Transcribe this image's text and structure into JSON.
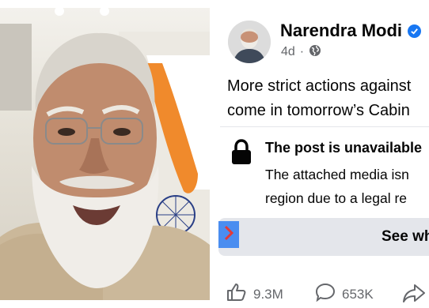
{
  "post": {
    "author": "Narendra Modi",
    "time": "4d",
    "text_line1": "More strict actions against",
    "text_line2": "come in tomorrow’s Cabin",
    "unavailable_title": "The post is unavailable",
    "unavailable_line1": "The attached media isn",
    "unavailable_line2": "region due to a legal re",
    "see_why_label": "See wh",
    "likes": "9.3M",
    "comments": "653K"
  },
  "icons": {
    "verified": "verified-badge-icon",
    "audience": "globe-icon",
    "lock": "lock-icon",
    "arrow": "chevron-right-icon",
    "like": "thumbs-up-icon",
    "comment": "comment-bubble-icon",
    "share": "share-arrow-icon"
  },
  "colors": {
    "brand_blue": "#1877f2",
    "secondary_text": "#65676b",
    "button_bg": "#e4e6eb",
    "arrow_bg": "#4a8df0",
    "flag_saffron": "#f08a2c",
    "chakra_blue": "#2a3f86"
  }
}
